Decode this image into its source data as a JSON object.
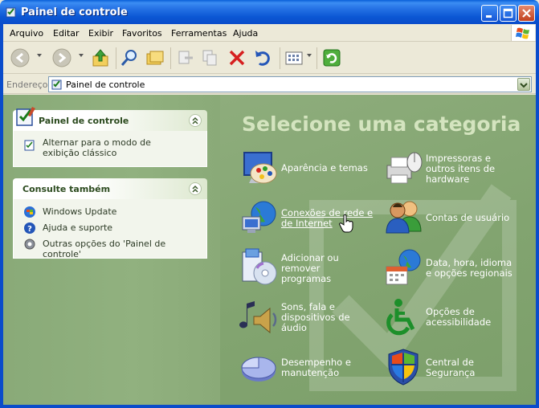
{
  "window": {
    "title": "Painel de controle"
  },
  "menu": [
    "Arquivo",
    "Editar",
    "Exibir",
    "Favoritos",
    "Ferramentas",
    "Ajuda"
  ],
  "address": {
    "label": "Endereço",
    "value": "Painel de controle"
  },
  "left_panel": {
    "control_panel": {
      "title": "Painel de controle",
      "link": "Alternar para o modo de exibição clássico"
    },
    "see_also": {
      "title": "Consulte também",
      "links": [
        "Windows Update",
        "Ajuda e suporte",
        "Outras opções do 'Painel de controle'"
      ]
    }
  },
  "main": {
    "heading": "Selecione uma categoria",
    "categories": [
      "Aparência e temas",
      "Impressoras e\noutros itens de\nhardware",
      "Conexões de rede e\nde Internet",
      "Contas de usuário",
      "Adicionar ou\nremover\nprogramas",
      "Data, hora, idioma\ne opções regionais",
      "Sons, fala e\ndispositivos de\náudio",
      "Opções de\nacessibilidade",
      "Desempenho e\nmanutenção",
      "Central de\nSegurança"
    ]
  },
  "icons": {
    "back": "back-arrow-icon",
    "forward": "forward-arrow-icon",
    "up": "folder-up-icon",
    "search": "search-icon",
    "folders": "folders-icon",
    "move": "move-to-icon",
    "copy": "copy-to-icon",
    "delete": "delete-icon",
    "undo": "undo-icon",
    "views": "views-icon",
    "go": "go-icon"
  },
  "colors": {
    "title_bar": "#0a57d4",
    "pane_green": "#82a470",
    "heading": "#d4e4bf",
    "link_text": "#2c3a25"
  }
}
